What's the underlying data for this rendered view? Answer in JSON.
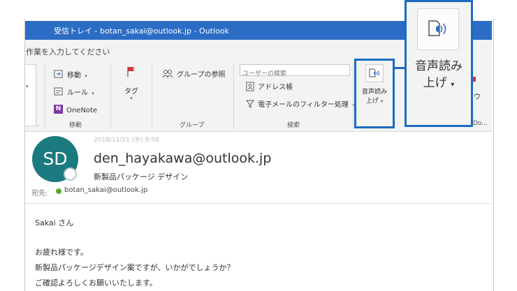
{
  "window": {
    "title": "受信トレイ - botan_sakai@outlook.jp -  Outlook"
  },
  "tell_me": {
    "placeholder": "作業を入力してください"
  },
  "ribbon": {
    "move_group": {
      "move_label": "移動",
      "rules_label": "ルール",
      "onenote_label": "OneNote",
      "group_label": "移動"
    },
    "tags_group": {
      "tag_label": "タグ"
    },
    "groups_group": {
      "browse_groups_label": "グループの参照",
      "group_label": "グループ"
    },
    "find_group": {
      "search_people_placeholder": "ユーザーの検索",
      "address_book_label": "アドレス帳",
      "filter_email_label": "電子メールのフィルター処理",
      "group_label": "検索"
    },
    "speech_group": {
      "read_aloud_line1": "音声読み",
      "read_aloud_line2": "上げ"
    },
    "partial_labels": {
      "partial_right_1": "ウ",
      "partial_right_2": "Do..."
    }
  },
  "callout": {
    "label_line1": "音声読み",
    "label_line2": "上げ"
  },
  "message": {
    "date": "2018/11/21 (水) 9:58",
    "avatar_initials": "SD",
    "from": "den_hayakawa@outlook.jp",
    "subject": "新製品パッケージ デザイン",
    "to_label": "宛先:",
    "to_address": "botan_sakai@outlook.jp",
    "body_lines": [
      "Sakai さん",
      "お疲れ様です。",
      "新製品パッケージデザイン案ですが、いかがでしょうか？",
      "ご確認よろしくお願いいたします。"
    ]
  },
  "colors": {
    "titlebar": "#2b6cc4",
    "highlight": "#1a6bc0",
    "avatar": "#1b7a80",
    "flag": "#d9333f",
    "onenote": "#7b3aa1"
  },
  "icons": [
    "move-icon",
    "rules-icon",
    "onenote-icon",
    "flag-icon",
    "groups-icon",
    "address-book-icon",
    "filter-icon",
    "read-aloud-icon"
  ]
}
